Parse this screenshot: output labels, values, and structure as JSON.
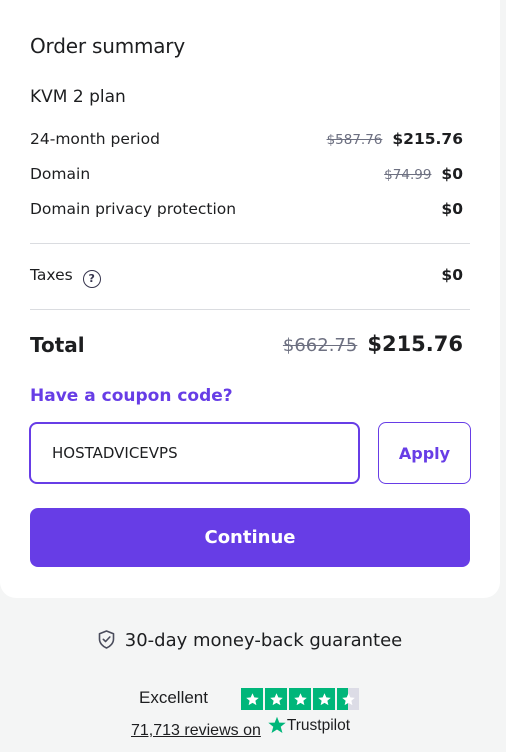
{
  "summary": {
    "title": "Order summary",
    "plan": "KVM 2 plan",
    "items": [
      {
        "label": "24-month period",
        "old_price": "$587.76",
        "price": "$215.76"
      },
      {
        "label": "Domain",
        "old_price": "$74.99",
        "price": "$0"
      },
      {
        "label": "Domain privacy protection",
        "old_price": "",
        "price": "$0"
      }
    ],
    "taxes": {
      "label": "Taxes",
      "help_icon": "?",
      "price": "$0"
    },
    "total": {
      "label": "Total",
      "old_price": "$662.75",
      "price": "$215.76"
    }
  },
  "coupon": {
    "link_label": "Have a coupon code?",
    "value": "HOSTADVICEVPS",
    "apply_label": "Apply"
  },
  "continue_label": "Continue",
  "guarantee": {
    "text": "30-day money-back guarantee",
    "icon": "shield-check-icon"
  },
  "trustpilot": {
    "rating_text": "Excellent",
    "stars": 4.5,
    "reviews_count": "71,713",
    "reviews_text": "reviews on",
    "brand": "Trustpilot"
  },
  "colors": {
    "accent": "#673de6",
    "trustpilot_green": "#00b67a"
  }
}
